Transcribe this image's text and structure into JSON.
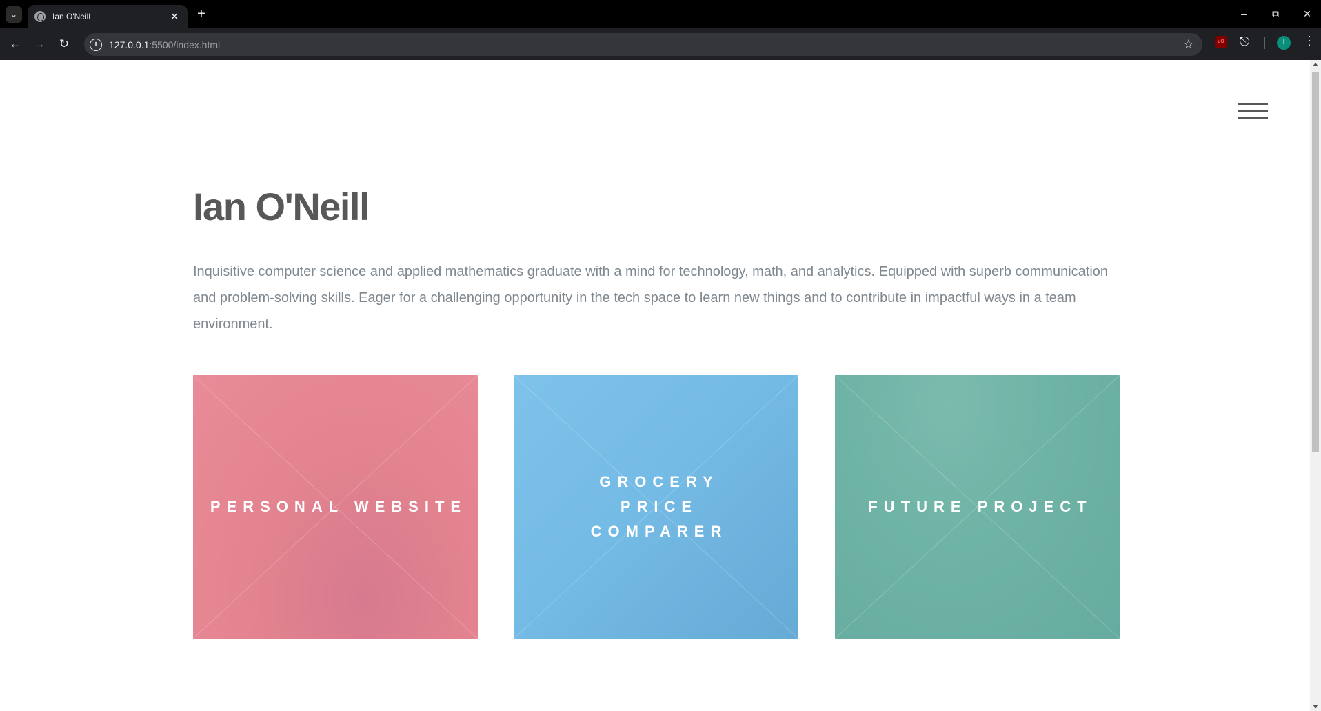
{
  "browser": {
    "tab_title": "Ian O'Neill",
    "tab_close": "✕",
    "new_tab": "+",
    "url_host": "127.0.0.1",
    "url_path": ":5500/index.html",
    "profile_initial": "I",
    "ublock_label": "uO"
  },
  "page": {
    "name": "Ian O'Neill",
    "bio": "Inquisitive computer science and applied mathematics graduate with a mind for technology, math, and analytics. Equipped with superb communication and problem-solving skills. Eager for a challenging opportunity in the tech space to learn new things and to contribute in impactful ways in a team environment.",
    "tiles": [
      {
        "title": "Personal Website",
        "color": "#e3838f"
      },
      {
        "title": "Grocery Price Comparer",
        "color": "#74bbe5"
      },
      {
        "title": "Future Project",
        "color": "#6fb4a6"
      }
    ]
  },
  "colors": {
    "heading": "#585858",
    "body_text": "#7f888f",
    "chrome_bg": "#1f2023"
  },
  "icons": {
    "menu": "hamburger-icon",
    "back": "arrow-left-icon",
    "forward": "arrow-right-icon",
    "reload": "reload-icon",
    "bookmark": "star-icon"
  }
}
